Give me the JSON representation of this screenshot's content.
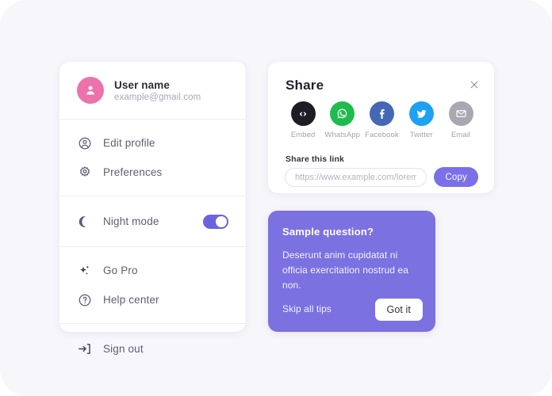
{
  "colors": {
    "page_background": "#f7f6fb",
    "accent_purple": "#7b70e8",
    "toggle_on": "#6c63dc",
    "avatar_pink": "#ec72ab",
    "tip_card": "#7b71e0",
    "embed": "#1d1d26",
    "whatsapp": "#1ebc4d",
    "facebook": "#4468b4",
    "twitter": "#1da1f2",
    "email": "#a8a8b3"
  },
  "menu_card": {
    "profile": {
      "name": "User name",
      "email": "example@gmail.com",
      "avatar_icon": "user-avatar-icon"
    },
    "group_account": [
      {
        "label": "Edit profile",
        "icon": "user-circle-icon"
      },
      {
        "label": "Preferences",
        "icon": "gear-icon"
      }
    ],
    "group_night": {
      "label": "Night mode",
      "icon": "moon-icon",
      "toggle_state": "on"
    },
    "group_extras": [
      {
        "label": "Go Pro",
        "icon": "sparkle-icon"
      },
      {
        "label": "Help center",
        "icon": "question-circle-icon"
      }
    ],
    "group_session": [
      {
        "label": "Sign out",
        "icon": "sign-out-icon"
      }
    ]
  },
  "share_card": {
    "title": "Share",
    "close_icon": "close-icon",
    "targets": [
      {
        "label": "Embed",
        "icon": "code-icon",
        "color": "#1d1d26"
      },
      {
        "label": "WhatsApp",
        "icon": "whatsapp-icon",
        "color": "#1ebc4d"
      },
      {
        "label": "Facebook",
        "icon": "facebook-icon",
        "color": "#4468b4"
      },
      {
        "label": "Twitter",
        "icon": "twitter-icon",
        "color": "#1da1f2"
      },
      {
        "label": "Email",
        "icon": "envelope-icon",
        "color": "#a8a8b3"
      }
    ],
    "link_label": "Share this link",
    "link_value": "",
    "link_placeholder": "https://www.example.com/lorem_ipsu",
    "copy_label": "Copy"
  },
  "tip_card": {
    "title": "Sample question?",
    "body": "Deserunt anim cupidatat ni officia exercitation nostrud ea non.",
    "skip_label": "Skip all tips",
    "confirm_label": "Got it"
  }
}
